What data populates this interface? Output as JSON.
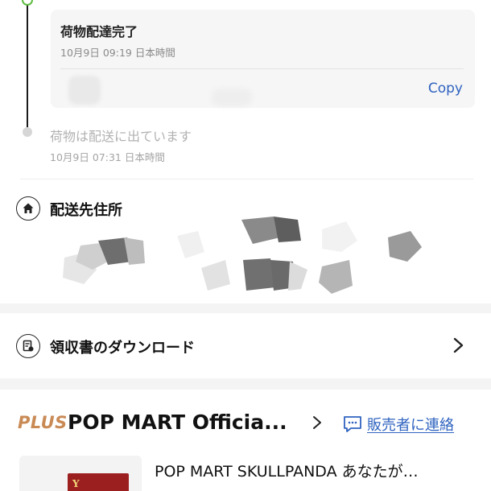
{
  "tracking": {
    "events": [
      {
        "title": "荷物配達完了",
        "time": "10月9日 09:19 日本時間"
      },
      {
        "title": "荷物は配送に出ています",
        "time": "10月9日 07:31 日本時間"
      }
    ],
    "copy_label": "Copy",
    "active_dot_color": "#5dbb3f"
  },
  "address": {
    "title": "配送先住所",
    "icon": "home-icon"
  },
  "receipt": {
    "label": "領収書のダウンロード",
    "icon": "receipt-icon"
  },
  "store": {
    "badge": "PLUS",
    "name": "POP MART Officia...",
    "contact_label": "販売者に連絡",
    "accent_color": "#2f63c0"
  },
  "product": {
    "title": "POP MART SKULLPANDA あなたが…",
    "box_text": "Y"
  }
}
